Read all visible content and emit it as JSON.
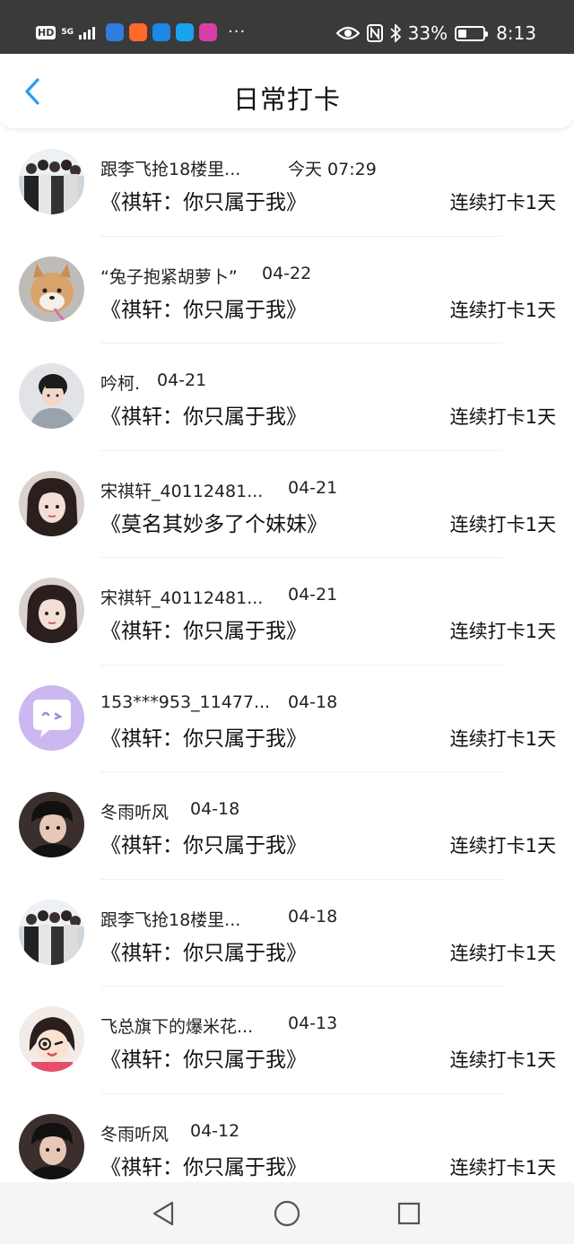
{
  "status_bar": {
    "hd": "HD",
    "network": "5G",
    "more": "···",
    "battery": "33%",
    "battery_level": 0.33,
    "time": "8:13",
    "icons": [
      "eye-icon",
      "nfc-icon",
      "bluetooth-icon"
    ]
  },
  "header": {
    "title": "日常打卡",
    "back_icon": "chevron-left-icon",
    "accent": "#2a9cf0"
  },
  "rows": [
    {
      "name": "跟李飞抢18楼里...",
      "date": "今天 07:29",
      "book": "《祺轩：你只属于我》",
      "streak": "连续打卡1天",
      "avatar": "group-photo"
    },
    {
      "name": "“兔子抱紧胡萝卜”",
      "date": "04-22",
      "book": "《祺轩：你只属于我》",
      "streak": "连续打卡1天",
      "avatar": "shiba-dog"
    },
    {
      "name": "吟柯.",
      "date": "04-21",
      "book": "《祺轩：你只属于我》",
      "streak": "连续打卡1天",
      "avatar": "boy-photo"
    },
    {
      "name": "宋祺轩_40112481...",
      "date": "04-21",
      "book": "《莫名其妙多了个妹妹》",
      "streak": "连续打卡1天",
      "avatar": "girl-photo"
    },
    {
      "name": "宋祺轩_40112481...",
      "date": "04-21",
      "book": "《祺轩：你只属于我》",
      "streak": "连续打卡1天",
      "avatar": "girl-photo"
    },
    {
      "name": "153***953_11477...",
      "date": "04-18",
      "book": "《祺轩：你只属于我》",
      "streak": "连续打卡1天",
      "avatar": "default-chat"
    },
    {
      "name": "冬雨听风",
      "date": "04-18",
      "book": "《祺轩：你只属于我》",
      "streak": "连续打卡1天",
      "avatar": "boy-dark-photo"
    },
    {
      "name": "跟李飞抢18楼里...",
      "date": "04-18",
      "book": "《祺轩：你只属于我》",
      "streak": "连续打卡1天",
      "avatar": "group-photo"
    },
    {
      "name": "飞总旗下的爆米花...",
      "date": "04-13",
      "book": "《祺轩：你只属于我》",
      "streak": "连续打卡1天",
      "avatar": "cartoon-girl"
    },
    {
      "name": "冬雨听风",
      "date": "04-12",
      "book": "《祺轩：你只属于我》",
      "streak": "连续打卡1天",
      "avatar": "boy-dark-photo"
    }
  ],
  "navbar": {
    "icons": [
      "back-triangle-icon",
      "home-circle-icon",
      "recents-square-icon"
    ]
  }
}
